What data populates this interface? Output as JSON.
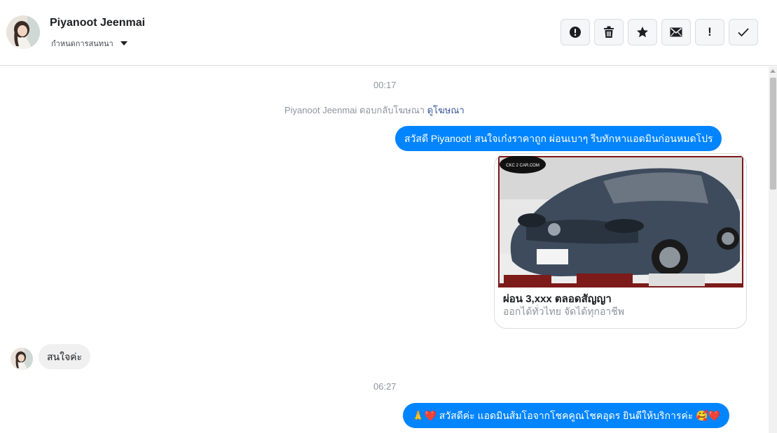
{
  "header": {
    "contact_name": "Piyanoot Jeenmai",
    "assign_label": "กำหนดการสนทนา",
    "toolbar": [
      {
        "name": "report-spam-button",
        "icon": "alert-circle-icon"
      },
      {
        "name": "delete-button",
        "icon": "trash-icon"
      },
      {
        "name": "star-button",
        "icon": "star-icon"
      },
      {
        "name": "mark-unread-button",
        "icon": "envelope-icon"
      },
      {
        "name": "follow-up-button",
        "icon": "exclamation-icon",
        "text": "!"
      },
      {
        "name": "mark-done-button",
        "icon": "checkmark-icon"
      }
    ]
  },
  "thread": {
    "time_1": "00:17",
    "system_note": {
      "text": "Piyanoot Jeenmai ตอบกลับโฆษณา",
      "link": "ดูโฆษณา"
    },
    "out_msg_1": "สวัสดี Piyanoot! สนใจเก๋งราคาถูก ผ่อนเบาๆ รีบทักหาแอดมินก่อนหมดโปร",
    "ad_card": {
      "image_badge": "CKC 2 CAR.COM",
      "title": "ผ่อน 3,xxx ตลอดสัญญา",
      "subtitle": "ออกได้ทั่วไทย จัดได้ทุกอาชีพ"
    },
    "in_msg_1": "สนใจค่ะ",
    "time_2": "06:27",
    "out_msg_2": "สวัสดีค่ะ แอดมินส้มโอจากโชคคูณโชคอุดร ยินดีให้บริการค่ะ"
  },
  "colors": {
    "messenger_blue": "#0084ff",
    "incoming_bubble": "#f0f0f0",
    "muted_text": "#8d949e",
    "link": "#385898"
  }
}
